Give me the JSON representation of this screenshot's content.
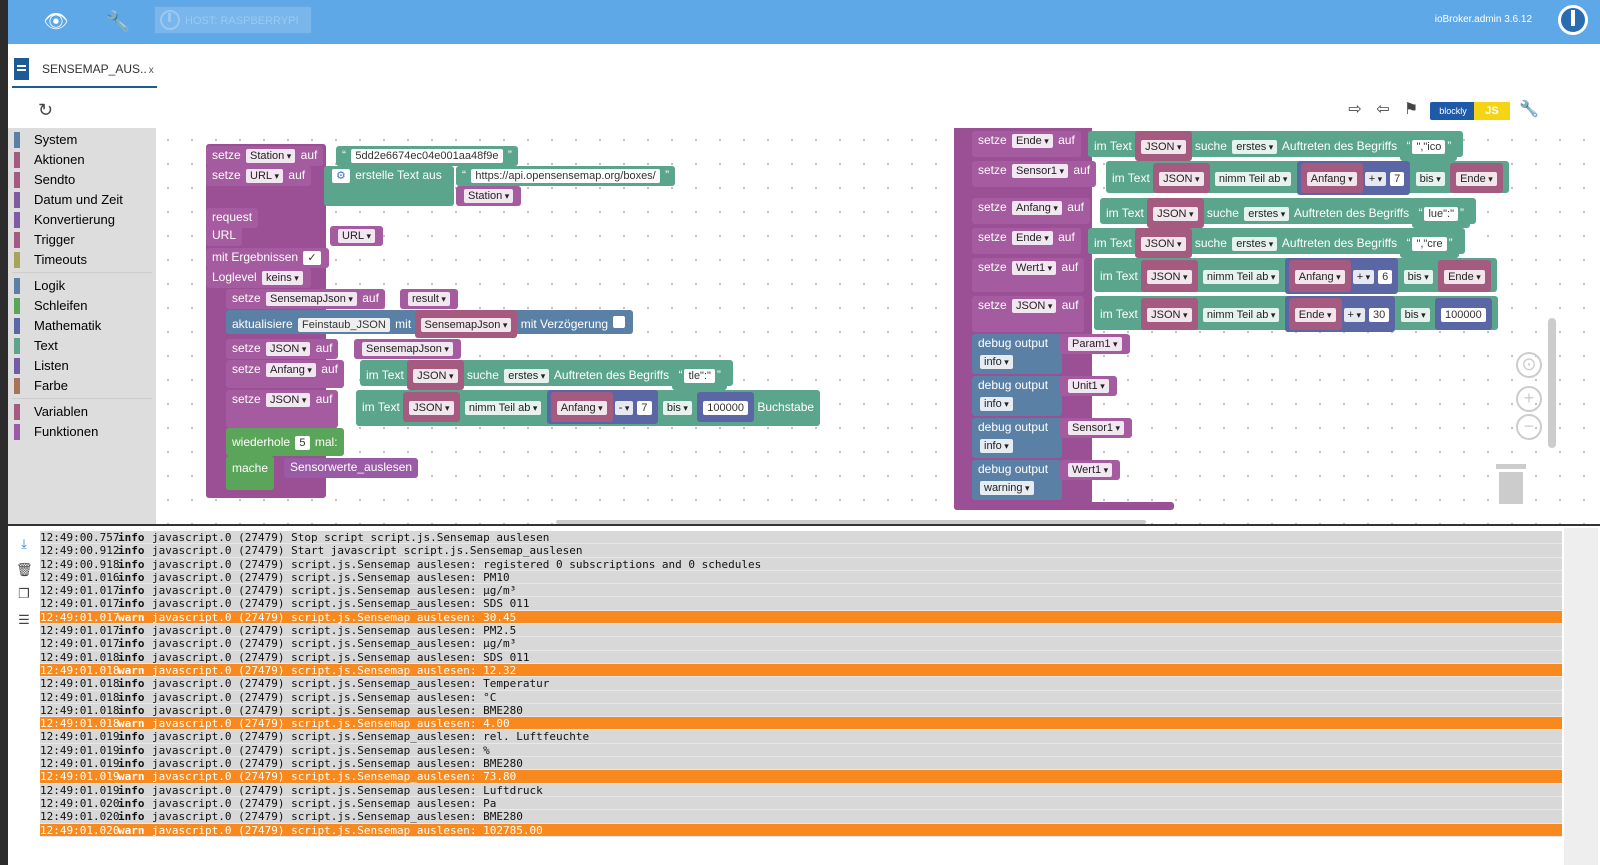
{
  "topbar": {
    "host_label": "HOST: RASPBERRYPI",
    "admin_version": "ioBroker.admin 3.6.12"
  },
  "tab": {
    "label": "SENSEMAP_AUS..",
    "close": "x"
  },
  "toolbar": {
    "blockly": "blockly",
    "js": "JS"
  },
  "sidebar": {
    "items": [
      {
        "label": "System",
        "color": "#5b80a5"
      },
      {
        "label": "Aktionen",
        "color": "#a55b80"
      },
      {
        "label": "Sendto",
        "color": "#a55b80"
      },
      {
        "label": "Datum und Zeit",
        "color": "#805ba5"
      },
      {
        "label": "Konvertierung",
        "color": "#805ba5"
      },
      {
        "label": "Trigger",
        "color": "#a55b80"
      },
      {
        "label": "Timeouts",
        "color": "#a5a55b"
      },
      {
        "label": "Logik",
        "color": "#5b80a5"
      },
      {
        "label": "Schleifen",
        "color": "#5ba55b"
      },
      {
        "label": "Mathematik",
        "color": "#5b67a5"
      },
      {
        "label": "Text",
        "color": "#5ba58c"
      },
      {
        "label": "Listen",
        "color": "#745ba5"
      },
      {
        "label": "Farbe",
        "color": "#a5745b"
      },
      {
        "label": "Variablen",
        "color": "#a55b80"
      },
      {
        "label": "Funktionen",
        "color": "#995ba5"
      }
    ]
  },
  "blocks": {
    "setze": "setze",
    "auf": "auf",
    "station": "Station",
    "station_id": "5dd2e6674ec04e001aa48f9e",
    "url": "URL",
    "erstelle_text": "erstelle Text aus",
    "api_url": "https://api.opensensemap.org/boxes/",
    "request": "request",
    "mit_ergebnissen": "mit Ergebnissen",
    "loglevel": "Loglevel",
    "keins": "keins",
    "sensemapjson": "SensemapJson",
    "result": "result",
    "aktualisiere": "aktualisiere",
    "feinstaub": "Feinstaub_JSON",
    "mit": "mit",
    "mit_verzoegerung": "mit Verzögerung",
    "json": "JSON",
    "anfang": "Anfang",
    "im_text": "im Text",
    "suche": "suche",
    "erstes": "erstes",
    "auftreten": "Auftreten des Begriffs",
    "tle": "tle\":\"",
    "nimm_teil": "nimm Teil ab",
    "minus": "-",
    "plus": "+",
    "seven": "7",
    "bis": "bis",
    "big": "100000",
    "buchstabe": "Buchstabe",
    "wiederhole": "wiederhole",
    "five": "5",
    "mal": "mal:",
    "mache": "mache",
    "sensorwerte": "Sensorwerte_auslesen",
    "ende": "Ende",
    "ico": "\",\"ico",
    "sensor1": "Sensor1",
    "lue": "lue\":\"",
    "cre": "\",\"cre",
    "wert1": "Wert1",
    "six": "6",
    "thirty": "30",
    "ende_trunc": "Ende",
    "debug_output": "debug output",
    "param1": "Param1",
    "unit1": "Unit1",
    "info": "info",
    "warning": "warning"
  },
  "log": [
    {
      "time": "12:49:00.757",
      "level": "info",
      "msg": "javascript.0 (27479) Stop script script.js.Sensemap_auslesen"
    },
    {
      "time": "12:49:00.912",
      "level": "info",
      "msg": "javascript.0 (27479) Start javascript script.js.Sensemap_auslesen"
    },
    {
      "time": "12:49:00.918",
      "level": "info",
      "msg": "javascript.0 (27479) script.js.Sensemap_auslesen: registered 0 subscriptions and 0 schedules"
    },
    {
      "time": "12:49:01.016",
      "level": "info",
      "msg": "javascript.0 (27479) script.js.Sensemap_auslesen: PM10"
    },
    {
      "time": "12:49:01.017",
      "level": "info",
      "msg": "javascript.0 (27479) script.js.Sensemap_auslesen: µg/m³"
    },
    {
      "time": "12:49:01.017",
      "level": "info",
      "msg": "javascript.0 (27479) script.js.Sensemap_auslesen: SDS 011"
    },
    {
      "time": "12:49:01.017",
      "level": "warn",
      "msg": "javascript.0 (27479) script.js.Sensemap_auslesen: 30.45"
    },
    {
      "time": "12:49:01.017",
      "level": "info",
      "msg": "javascript.0 (27479) script.js.Sensemap_auslesen: PM2.5"
    },
    {
      "time": "12:49:01.017",
      "level": "info",
      "msg": "javascript.0 (27479) script.js.Sensemap_auslesen: µg/m³"
    },
    {
      "time": "12:49:01.018",
      "level": "info",
      "msg": "javascript.0 (27479) script.js.Sensemap_auslesen: SDS 011"
    },
    {
      "time": "12:49:01.018",
      "level": "warn",
      "msg": "javascript.0 (27479) script.js.Sensemap_auslesen: 12.32"
    },
    {
      "time": "12:49:01.018",
      "level": "info",
      "msg": "javascript.0 (27479) script.js.Sensemap_auslesen: Temperatur"
    },
    {
      "time": "12:49:01.018",
      "level": "info",
      "msg": "javascript.0 (27479) script.js.Sensemap_auslesen: °C"
    },
    {
      "time": "12:49:01.018",
      "level": "info",
      "msg": "javascript.0 (27479) script.js.Sensemap_auslesen: BME280"
    },
    {
      "time": "12:49:01.018",
      "level": "warn",
      "msg": "javascript.0 (27479) script.js.Sensemap_auslesen: 4.00"
    },
    {
      "time": "12:49:01.019",
      "level": "info",
      "msg": "javascript.0 (27479) script.js.Sensemap_auslesen: rel. Luftfeuchte"
    },
    {
      "time": "12:49:01.019",
      "level": "info",
      "msg": "javascript.0 (27479) script.js.Sensemap_auslesen: %"
    },
    {
      "time": "12:49:01.019",
      "level": "info",
      "msg": "javascript.0 (27479) script.js.Sensemap_auslesen: BME280"
    },
    {
      "time": "12:49:01.019",
      "level": "warn",
      "msg": "javascript.0 (27479) script.js.Sensemap_auslesen: 73.80"
    },
    {
      "time": "12:49:01.019",
      "level": "info",
      "msg": "javascript.0 (27479) script.js.Sensemap_auslesen: Luftdruck"
    },
    {
      "time": "12:49:01.020",
      "level": "info",
      "msg": "javascript.0 (27479) script.js.Sensemap_auslesen: Pa"
    },
    {
      "time": "12:49:01.020",
      "level": "info",
      "msg": "javascript.0 (27479) script.js.Sensemap_auslesen: BME280"
    },
    {
      "time": "12:49:01.020",
      "level": "warn",
      "msg": "javascript.0 (27479) script.js.Sensemap_auslesen: 102785.00"
    }
  ]
}
